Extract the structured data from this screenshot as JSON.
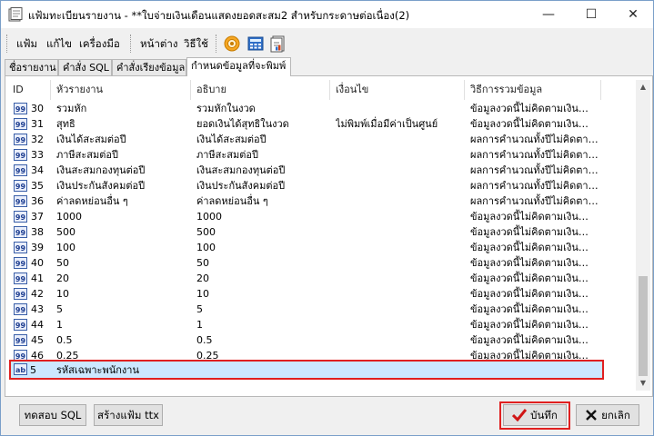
{
  "window": {
    "title": "แฟ้มทะเบียนรายงาน - **ใบจ่ายเงินเดือนแสดงยอดสะสม2 สำหรับกระดาษต่อเนื่อง(2)",
    "minimize": "—",
    "maximize": "☐",
    "close": "✕"
  },
  "menu": {
    "file": "แฟ้ม",
    "edit": "แก้ไข",
    "tools": "เครื่องมือ",
    "window": "หน้าต่าง",
    "help": "วิธีใช้"
  },
  "tabs": [
    {
      "label": "ชื่อรายงาน"
    },
    {
      "label": "คำสั่ง SQL"
    },
    {
      "label": "คำสั่งเรียงข้อมูล"
    },
    {
      "label": "กำหนดข้อมูลที่จะพิมพ์"
    }
  ],
  "table": {
    "columns": [
      "ID",
      "หัวรายงาน",
      "อธิบาย",
      "เงื่อนไข",
      "วิธีการรวมข้อมูล"
    ],
    "rows": [
      {
        "badge": "99",
        "id": "30",
        "header": "รวมหัก",
        "desc": "รวมหักในงวด",
        "cond": "",
        "method": "ข้อมูลงวดนี้ไม่คิดตามเงิน…"
      },
      {
        "badge": "99",
        "id": "31",
        "header": "สุทธิ",
        "desc": "ยอดเงินได้สุทธิในงวด",
        "cond": "ไม่พิมพ์เมื่อมีค่าเป็นศูนย์",
        "method": "ข้อมูลงวดนี้ไม่คิดตามเงิน…"
      },
      {
        "badge": "99",
        "id": "32",
        "header": "เงินได้สะสมต่อปี",
        "desc": "เงินได้สะสมต่อปี",
        "cond": "",
        "method": "ผลการคำนวณทั้งปีไม่คิดตา…"
      },
      {
        "badge": "99",
        "id": "33",
        "header": "ภาษีสะสมต่อปี",
        "desc": "ภาษีสะสมต่อปี",
        "cond": "",
        "method": "ผลการคำนวณทั้งปีไม่คิดตา…"
      },
      {
        "badge": "99",
        "id": "34",
        "header": "เงินสะสมกองทุนต่อปี",
        "desc": "เงินสะสมกองทุนต่อปี",
        "cond": "",
        "method": "ผลการคำนวณทั้งปีไม่คิดตา…"
      },
      {
        "badge": "99",
        "id": "35",
        "header": "เงินประกันสังคมต่อปี",
        "desc": "เงินประกันสังคมต่อปี",
        "cond": "",
        "method": "ผลการคำนวณทั้งปีไม่คิดตา…"
      },
      {
        "badge": "99",
        "id": "36",
        "header": "ค่าลดหย่อนอื่น ๆ",
        "desc": "ค่าลดหย่อนอื่น ๆ",
        "cond": "",
        "method": "ผลการคำนวณทั้งปีไม่คิดตา…"
      },
      {
        "badge": "99",
        "id": "37",
        "header": "1000",
        "desc": "1000",
        "cond": "",
        "method": "ข้อมูลงวดนี้ไม่คิดตามเงิน…"
      },
      {
        "badge": "99",
        "id": "38",
        "header": "500",
        "desc": "500",
        "cond": "",
        "method": "ข้อมูลงวดนี้ไม่คิดตามเงิน…"
      },
      {
        "badge": "99",
        "id": "39",
        "header": "100",
        "desc": "100",
        "cond": "",
        "method": "ข้อมูลงวดนี้ไม่คิดตามเงิน…"
      },
      {
        "badge": "99",
        "id": "40",
        "header": "50",
        "desc": "50",
        "cond": "",
        "method": "ข้อมูลงวดนี้ไม่คิดตามเงิน…"
      },
      {
        "badge": "99",
        "id": "41",
        "header": "20",
        "desc": "20",
        "cond": "",
        "method": "ข้อมูลงวดนี้ไม่คิดตามเงิน…"
      },
      {
        "badge": "99",
        "id": "42",
        "header": "10",
        "desc": "10",
        "cond": "",
        "method": "ข้อมูลงวดนี้ไม่คิดตามเงิน…"
      },
      {
        "badge": "99",
        "id": "43",
        "header": "5",
        "desc": "5",
        "cond": "",
        "method": "ข้อมูลงวดนี้ไม่คิดตามเงิน…"
      },
      {
        "badge": "99",
        "id": "44",
        "header": "1",
        "desc": "1",
        "cond": "",
        "method": "ข้อมูลงวดนี้ไม่คิดตามเงิน…"
      },
      {
        "badge": "99",
        "id": "45",
        "header": "0.5",
        "desc": "0.5",
        "cond": "",
        "method": "ข้อมูลงวดนี้ไม่คิดตามเงิน…"
      },
      {
        "badge": "99",
        "id": "46",
        "header": "0.25",
        "desc": "0.25",
        "cond": "",
        "method": "ข้อมูลงวดนี้ไม่คิดตามเงิน…"
      }
    ],
    "selected": {
      "badge": "ab",
      "id": "5",
      "header": "รหัสเฉพาะพนักงาน"
    }
  },
  "buttons": {
    "test_sql": "ทดสอบ SQL",
    "create_ttx": "สร้างแฟ้ม ttx",
    "save": "บันทึก",
    "cancel": "ยกเลิก"
  },
  "colors": {
    "highlight": "#e02020",
    "selection": "#cce8ff",
    "check": "#d01515"
  }
}
